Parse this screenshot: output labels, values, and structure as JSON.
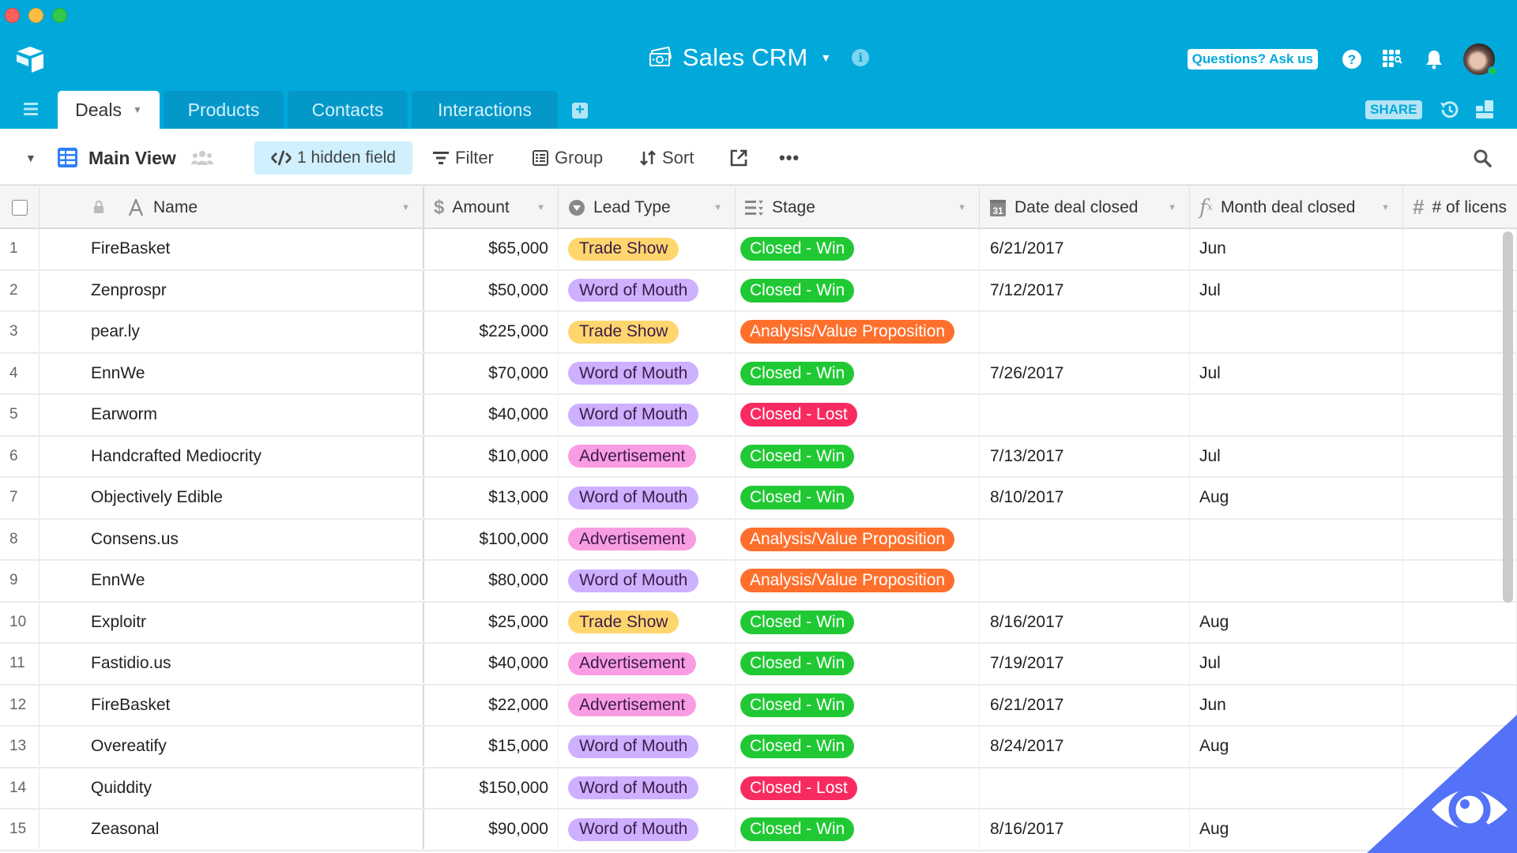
{
  "app": {
    "base_title": "Sales CRM",
    "base_icon": "money-icon",
    "ask_button": "Questions? Ask us",
    "share_label": "SHARE"
  },
  "tabs": [
    {
      "label": "Deals",
      "active": true
    },
    {
      "label": "Products",
      "active": false
    },
    {
      "label": "Contacts",
      "active": false
    },
    {
      "label": "Interactions",
      "active": false
    }
  ],
  "toolbar": {
    "view_name": "Main View",
    "hidden_fields": "1 hidden field",
    "filter": "Filter",
    "group": "Group",
    "sort": "Sort",
    "more": "•••"
  },
  "columns": [
    {
      "label": "Name",
      "icon": "text-field-icon"
    },
    {
      "label": "Amount",
      "icon": "currency-field-icon"
    },
    {
      "label": "Lead Type",
      "icon": "single-select-icon"
    },
    {
      "label": "Stage",
      "icon": "multi-select-icon"
    },
    {
      "label": "Date deal closed",
      "icon": "calendar-field-icon"
    },
    {
      "label": "Month deal closed",
      "icon": "formula-field-icon"
    },
    {
      "label": "# of licens",
      "icon": "number-field-icon"
    }
  ],
  "colors": {
    "header_bg": "#01A9DB",
    "lead": {
      "Trade Show": "#FFD66E",
      "Word of Mouth": "#CDB0FF",
      "Advertisement": "#F99DE2"
    },
    "stage": {
      "Closed - Win": "#20C933",
      "Closed - Lost": "#F82B60",
      "Analysis/Value Proposition": "#FF6F2C"
    }
  },
  "rows": [
    {
      "n": "1",
      "name": "FireBasket",
      "amount": "$65,000",
      "lead": "Trade Show",
      "stage": "Closed - Win",
      "date": "6/21/2017",
      "month": "Jun"
    },
    {
      "n": "2",
      "name": "Zenprospr",
      "amount": "$50,000",
      "lead": "Word of Mouth",
      "stage": "Closed - Win",
      "date": "7/12/2017",
      "month": "Jul"
    },
    {
      "n": "3",
      "name": "pear.ly",
      "amount": "$225,000",
      "lead": "Trade Show",
      "stage": "Analysis/Value Proposition",
      "date": "",
      "month": ""
    },
    {
      "n": "4",
      "name": "EnnWe",
      "amount": "$70,000",
      "lead": "Word of Mouth",
      "stage": "Closed - Win",
      "date": "7/26/2017",
      "month": "Jul"
    },
    {
      "n": "5",
      "name": "Earworm",
      "amount": "$40,000",
      "lead": "Word of Mouth",
      "stage": "Closed - Lost",
      "date": "",
      "month": ""
    },
    {
      "n": "6",
      "name": "Handcrafted Mediocrity",
      "amount": "$10,000",
      "lead": "Advertisement",
      "stage": "Closed - Win",
      "date": "7/13/2017",
      "month": "Jul"
    },
    {
      "n": "7",
      "name": "Objectively Edible",
      "amount": "$13,000",
      "lead": "Word of Mouth",
      "stage": "Closed - Win",
      "date": "8/10/2017",
      "month": "Aug"
    },
    {
      "n": "8",
      "name": "Consens.us",
      "amount": "$100,000",
      "lead": "Advertisement",
      "stage": "Analysis/Value Proposition",
      "date": "",
      "month": ""
    },
    {
      "n": "9",
      "name": "EnnWe",
      "amount": "$80,000",
      "lead": "Word of Mouth",
      "stage": "Analysis/Value Proposition",
      "date": "",
      "month": ""
    },
    {
      "n": "10",
      "name": "Exploitr",
      "amount": "$25,000",
      "lead": "Trade Show",
      "stage": "Closed - Win",
      "date": "8/16/2017",
      "month": "Aug"
    },
    {
      "n": "11",
      "name": "Fastidio.us",
      "amount": "$40,000",
      "lead": "Advertisement",
      "stage": "Closed - Win",
      "date": "7/19/2017",
      "month": "Jul"
    },
    {
      "n": "12",
      "name": "FireBasket",
      "amount": "$22,000",
      "lead": "Advertisement",
      "stage": "Closed - Win",
      "date": "6/21/2017",
      "month": "Jun"
    },
    {
      "n": "13",
      "name": "Overeatify",
      "amount": "$15,000",
      "lead": "Word of Mouth",
      "stage": "Closed - Win",
      "date": "8/24/2017",
      "month": "Aug"
    },
    {
      "n": "14",
      "name": "Quiddity",
      "amount": "$150,000",
      "lead": "Word of Mouth",
      "stage": "Closed - Lost",
      "date": "",
      "month": ""
    },
    {
      "n": "15",
      "name": "Zeasonal",
      "amount": "$90,000",
      "lead": "Word of Mouth",
      "stage": "Closed - Win",
      "date": "8/16/2017",
      "month": "Aug"
    }
  ]
}
